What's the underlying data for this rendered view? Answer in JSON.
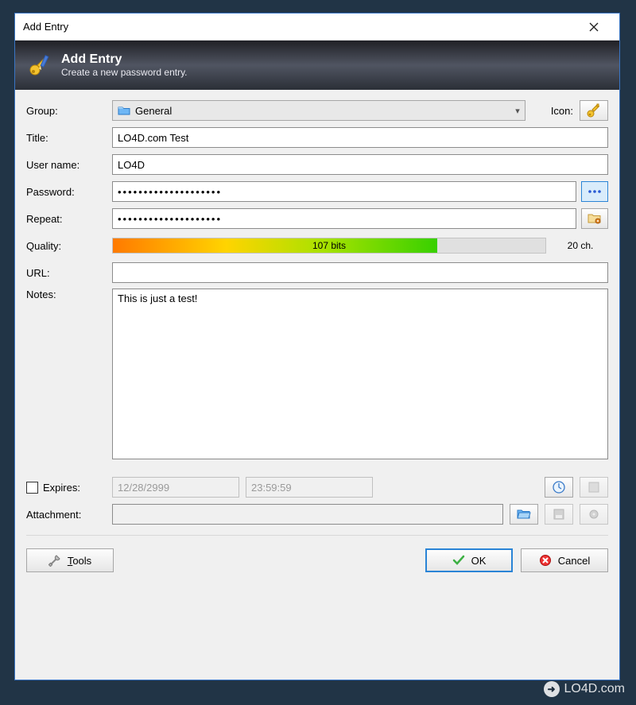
{
  "window": {
    "title": "Add Entry"
  },
  "banner": {
    "heading": "Add Entry",
    "subtitle": "Create a new password entry."
  },
  "labels": {
    "group": "Group:",
    "icon": "Icon:",
    "title": "Title:",
    "username": "User name:",
    "password": "Password:",
    "repeat": "Repeat:",
    "quality": "Quality:",
    "url": "URL:",
    "notes": "Notes:",
    "expires": "Expires:",
    "attachment": "Attachment:"
  },
  "values": {
    "group": "General",
    "title": "LO4D.com Test",
    "username": "LO4D",
    "password": "••••••••••••••••••••",
    "repeat": "••••••••••••••••••••",
    "quality_bits": "107 bits",
    "quality_chars": "20 ch.",
    "url": "",
    "notes": "This is just a test!",
    "expires_date": "12/28/2999",
    "expires_time": "23:59:59",
    "attachment": ""
  },
  "buttons": {
    "tools": "Tools",
    "ok": "OK",
    "cancel": "Cancel"
  },
  "watermark": "LO4D.com"
}
